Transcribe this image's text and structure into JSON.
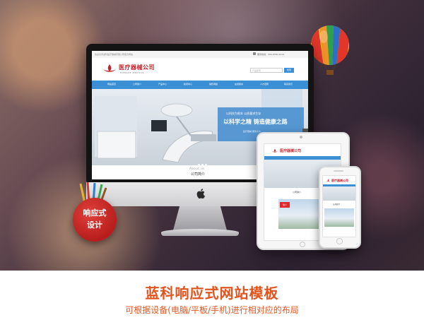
{
  "colors": {
    "brand_blue": "#3b8fd4",
    "brand_red": "#c4222a",
    "badge_red": "#c8211f",
    "title_orange": "#e2541d"
  },
  "desktop_site": {
    "topbar": {
      "welcome": "欢迎访问蓝科医疗器械有限公司官方网站",
      "hotline_label": "服务热线：",
      "hotline": "400-8790-2014"
    },
    "logo": {
      "cn": "医疗器械公司",
      "en": "HONGKE MEDICAL"
    },
    "search": {
      "placeholder": "产品搜索",
      "button": "搜索"
    },
    "nav": [
      "网站首页",
      "公司简介",
      "产品中心",
      "新闻中心",
      "销售网络",
      "在线留言",
      "人才招聘",
      "联系我们"
    ],
    "banner": {
      "line1": "以科技为根本 以质量求生存",
      "line2": "以科学之精  铸造健康之路",
      "line3": "医疗器械 服务大众"
    },
    "about": {
      "en": "About us",
      "cn": "公司简介"
    }
  },
  "tablet_site": {
    "logo_cn": "医疗器械公司",
    "about": "公司简介",
    "badge": "简介"
  },
  "phone_site": {
    "logo_cn": "医疗器械公司",
    "about": "公司简介"
  },
  "badge": {
    "line1": "响应式",
    "line2": "设计"
  },
  "headline": {
    "title": "蓝科响应式网站模板",
    "subtitle": "可根据设备(电脑/平板/手机)进行相对应的布局"
  },
  "icons": [
    "balloon-icon",
    "apple-logo-icon",
    "pen-cup-icon",
    "medical-logo-icon",
    "phone-icon"
  ]
}
